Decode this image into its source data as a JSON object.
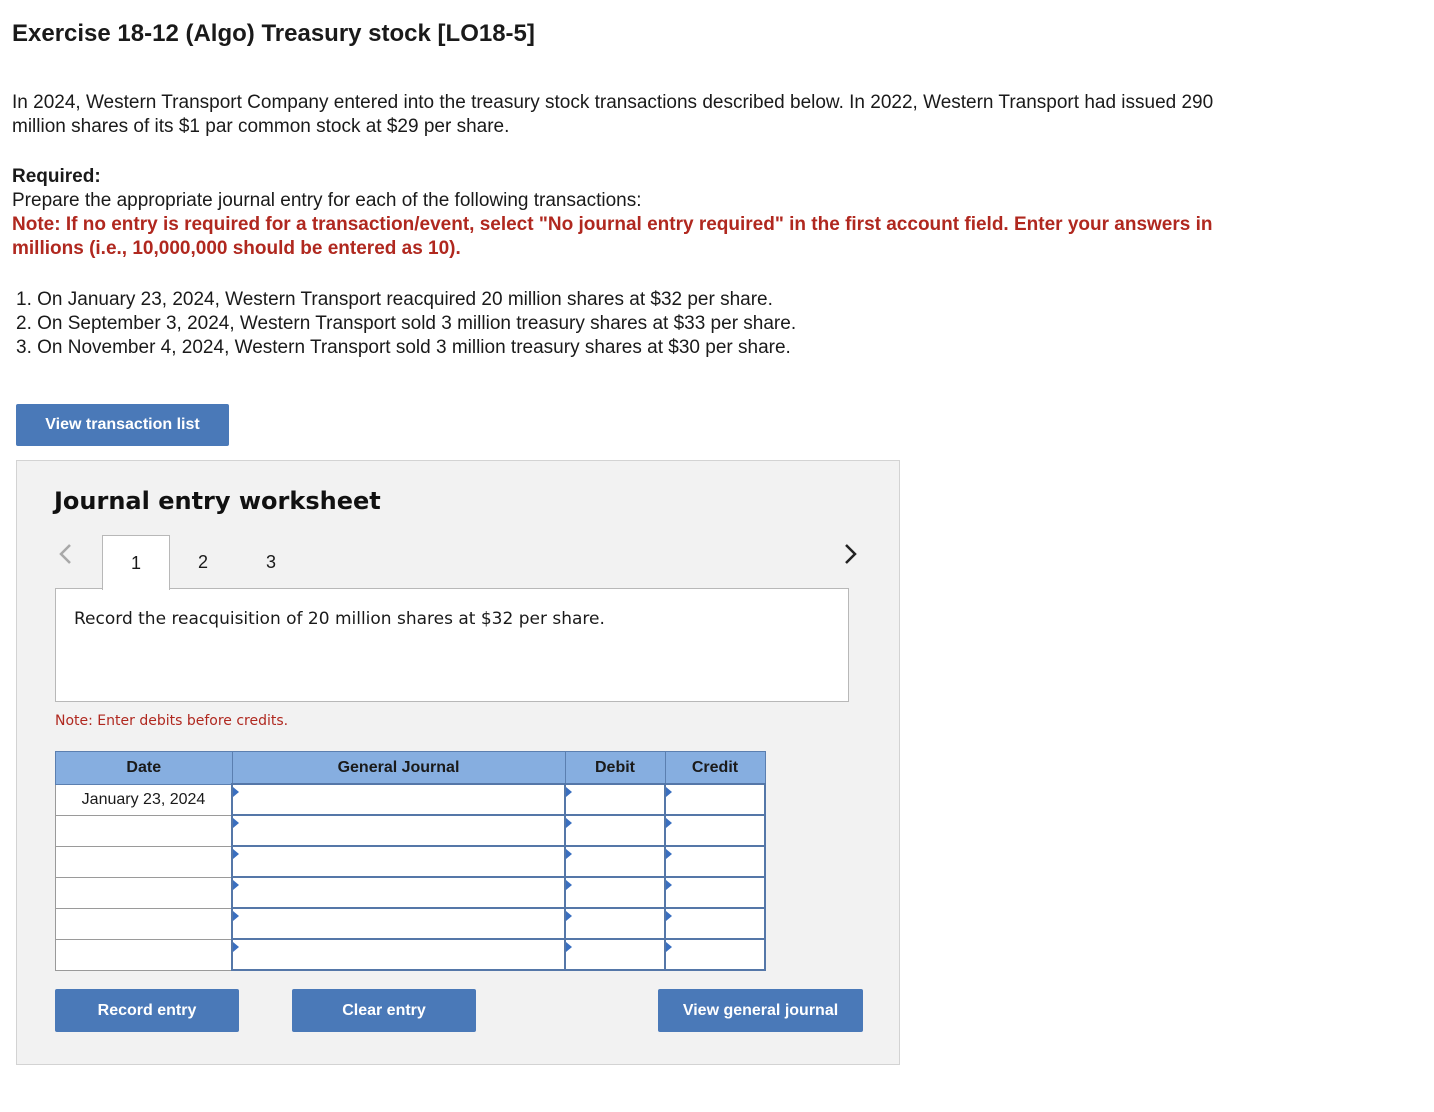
{
  "title": "Exercise 18-12 (Algo) Treasury stock [LO18-5]",
  "intro": "In 2024, Western Transport Company entered into the treasury stock transactions described below. In 2022, Western Transport had issued 290 million shares of its $1 par common stock at $29 per share.",
  "required": {
    "heading": "Required:",
    "text": "Prepare the appropriate journal entry for each of the following transactions:",
    "note": "Note: If no entry is required for a transaction/event, select \"No journal entry required\" in the first account field. Enter your answers in millions (i.e., 10,000,000 should be entered as 10)."
  },
  "transactions": [
    "1. On January 23, 2024, Western Transport reacquired 20 million shares at $32 per share.",
    "2. On September 3, 2024, Western Transport sold 3 million treasury shares at $33 per share.",
    "3. On November 4, 2024, Western Transport sold 3 million treasury shares at $30 per share."
  ],
  "view_transaction_list_label": "View transaction list",
  "worksheet": {
    "title": "Journal entry worksheet",
    "tabs": [
      "1",
      "2",
      "3"
    ],
    "active_tab": "1",
    "description": "Record the reacquisition of 20 million shares at $32 per share.",
    "enter_note": "Note: Enter debits before credits.",
    "columns": [
      "Date",
      "General Journal",
      "Debit",
      "Credit"
    ],
    "rows": [
      {
        "date": "January 23, 2024",
        "account": "",
        "debit": "",
        "credit": ""
      },
      {
        "date": "",
        "account": "",
        "debit": "",
        "credit": ""
      },
      {
        "date": "",
        "account": "",
        "debit": "",
        "credit": ""
      },
      {
        "date": "",
        "account": "",
        "debit": "",
        "credit": ""
      },
      {
        "date": "",
        "account": "",
        "debit": "",
        "credit": ""
      },
      {
        "date": "",
        "account": "",
        "debit": "",
        "credit": ""
      }
    ],
    "record_label": "Record entry",
    "clear_label": "Clear entry",
    "view_journal_label": "View general journal"
  },
  "colors": {
    "button_blue": "#4a79b8",
    "header_blue": "#86aee0",
    "note_red": "#b0281f"
  }
}
